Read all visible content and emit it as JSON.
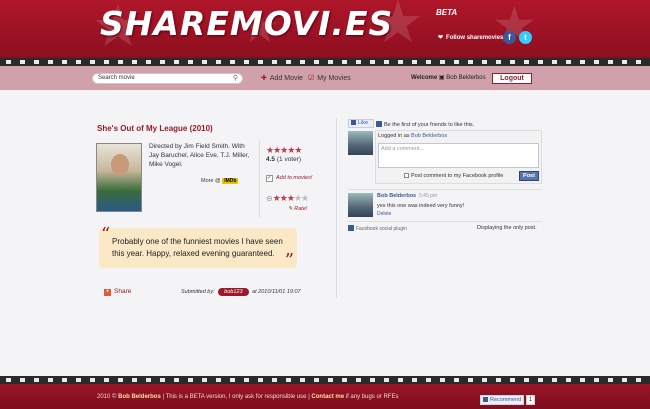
{
  "header": {
    "logo": "SHAREMOVI.ES",
    "beta": "BETA",
    "follow": "Follow sharemovies"
  },
  "nav": {
    "search_value": "Search movie",
    "add_movie": "Add Movie",
    "my_movies": "My Movies",
    "welcome": "Welcome",
    "user": "Bob Belderbos",
    "logout": "Logout"
  },
  "movie": {
    "title": "She's Out of My League (2010)",
    "directed": "Directed by Jim Field Smith. With Jay Baruchel, Alice Eve, T.J. Miller, Mike Vogel.",
    "more": "More @",
    "imdb": "IMDb",
    "rating_score": "4.5",
    "rating_voters": "(1 voter)",
    "rating_stars": 4.5,
    "user_rating_stars": 3,
    "add_to_movies": "Add to movies!",
    "rate": "Rate!",
    "review": "Probably one of the funniest movies I have seen this year. Happy, relaxed evening guaranteed.",
    "share": "Share",
    "submitted_by": "Submitted by:",
    "submitter": "bob123",
    "submitted_at": "at 2010/11/01 19:07"
  },
  "facebook": {
    "like": "Like",
    "like_text": "Be the first of your friends to like this.",
    "logged_in_prefix": "Logged in as",
    "logged_in_user": "Bob Belderbos",
    "comment_placeholder": "Add a comment...",
    "post_checkbox": "Post comment to my Facebook profile",
    "post_button": "Post",
    "comment_author": "Bob Belderbos",
    "comment_time": "5:45 pm",
    "comment_body": "yes this one was indeed very funny!",
    "comment_delete": "Delete",
    "plugin": "Facebook social plugin",
    "displaying": "Displaying the only post."
  },
  "footer": {
    "year": "2010 ©",
    "author": "Bob Belderbos",
    "beta_text": "| This is a BETA version, I only ask for responsible use |",
    "contact": "Contact me",
    "contact_suffix": "if any bugs or RFEs",
    "recommend": "Recommend",
    "recommend_count": "1"
  },
  "colors": {
    "brand_red": "#9a1a2a",
    "nav_pink": "#d0a0ab",
    "quote_bg": "#fae8c6",
    "facebook_blue": "#3b5998"
  }
}
